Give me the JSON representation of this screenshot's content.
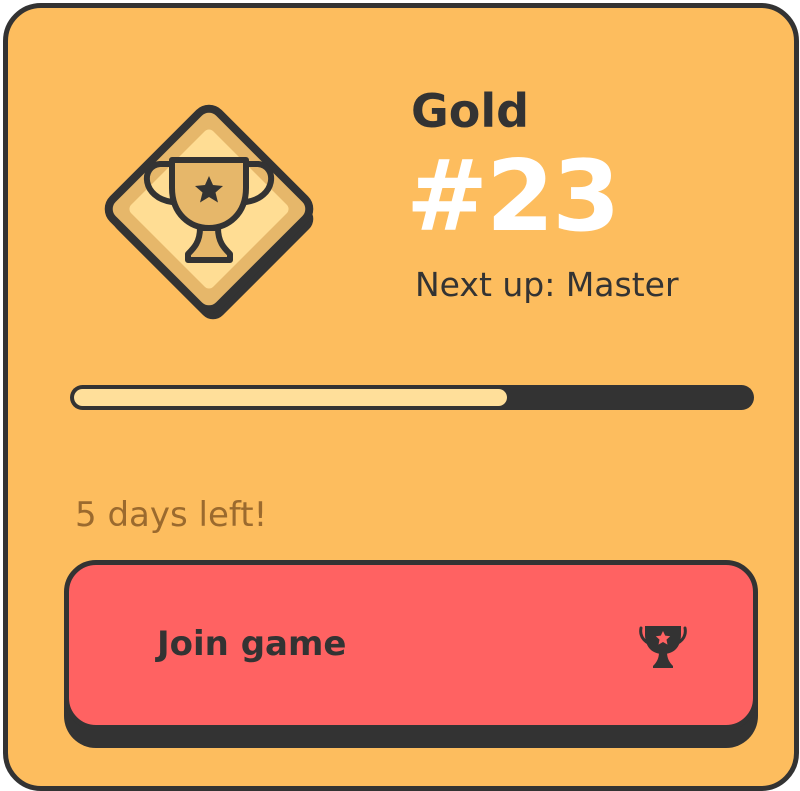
{
  "league": {
    "tier": "Gold",
    "rank": "#23",
    "next_label": "Next up: Master",
    "badge_icon": "trophy-icon",
    "progress": 0.64
  },
  "countdown": {
    "text": "5 days left!"
  },
  "join_button": {
    "label": "Join game",
    "icon": "trophy-icon"
  },
  "colors": {
    "card_background": "#fdbd5e",
    "outline": "#333333",
    "rank_text": "#ffffff",
    "progress_fill": "#ffdf9a",
    "countdown_text": "#9b6a2e",
    "button_background": "#ff6262",
    "badge_light": "#ffdf9a",
    "badge_dark": "#e6a84a"
  }
}
